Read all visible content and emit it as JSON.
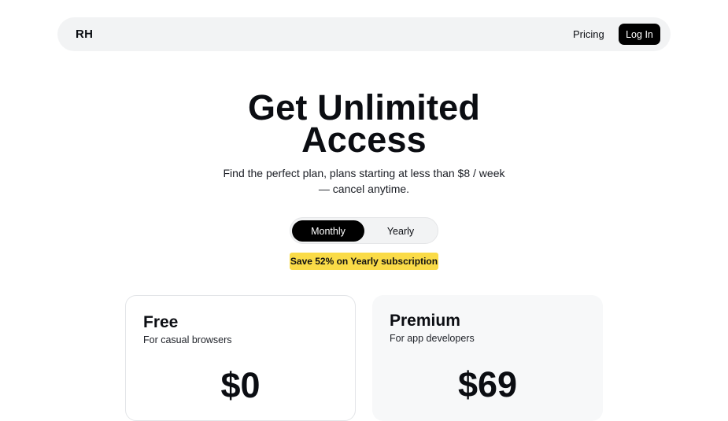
{
  "nav": {
    "logo": "RH",
    "links": [
      "Pricing"
    ],
    "login_label": "Log In"
  },
  "hero": {
    "title_line1": "Get Unlimited",
    "title_line2": "Access",
    "subtitle": "Find the perfect plan, plans starting at less than $8 / week — cancel anytime."
  },
  "billing_toggle": {
    "options": [
      "Monthly",
      "Yearly"
    ],
    "selected": "Monthly"
  },
  "promo_badge": "Save 52% on Yearly subscription",
  "plans": [
    {
      "name": "Free",
      "description": "For casual browsers",
      "price": "$0"
    },
    {
      "name": "Premium",
      "description": "For app developers",
      "price": "$69"
    }
  ],
  "colors": {
    "navbar_bg": "#f2f3f4",
    "primary_button": "#000000",
    "promo_badge": "#fadb47",
    "premium_card_bg": "#f7f8f9",
    "text": "#0b0d12"
  }
}
